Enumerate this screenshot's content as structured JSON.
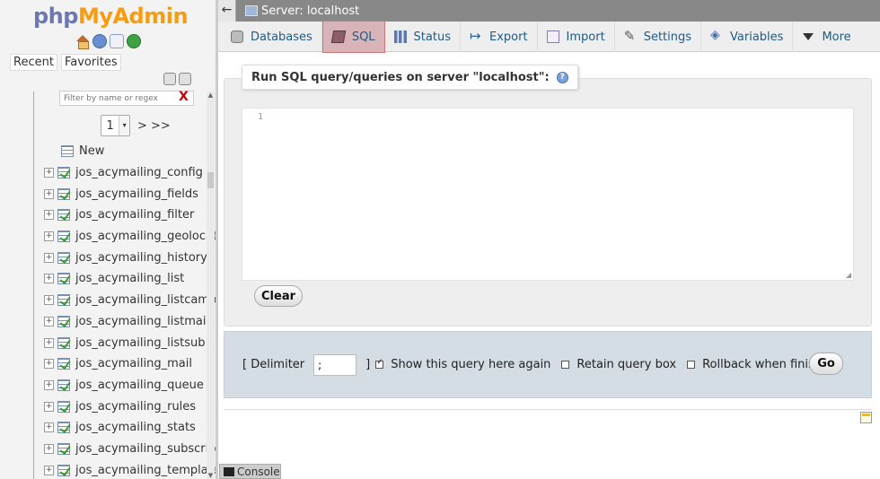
{
  "logo": {
    "php": "php",
    "myadmin": "MyAdmin"
  },
  "nav": {
    "recent_label": "Recent",
    "favorites_label": "Favorites",
    "filter_placeholder": "Filter by name or regex",
    "filter_clear": "X",
    "page_select_value": "1",
    "page_next": "> >>",
    "new_label": "New",
    "tables": [
      "jos_acymailing_config",
      "jos_acymailing_fields",
      "jos_acymailing_filter",
      "jos_acymailing_geolocati",
      "jos_acymailing_history",
      "jos_acymailing_list",
      "jos_acymailing_listcampa",
      "jos_acymailing_listmail",
      "jos_acymailing_listsub",
      "jos_acymailing_mail",
      "jos_acymailing_queue",
      "jos_acymailing_rules",
      "jos_acymailing_stats",
      "jos_acymailing_subscribe",
      "jos_acymailing_template"
    ]
  },
  "serverbar": {
    "collapse": "←",
    "label": "Server: localhost"
  },
  "tabs": [
    {
      "label": "Databases",
      "icon": "database-icon"
    },
    {
      "label": "SQL",
      "icon": "sql-icon",
      "active": true
    },
    {
      "label": "Status",
      "icon": "status-icon"
    },
    {
      "label": "Export",
      "icon": "export-icon"
    },
    {
      "label": "Import",
      "icon": "import-icon"
    },
    {
      "label": "Settings",
      "icon": "wrench-icon"
    },
    {
      "label": "Variables",
      "icon": "variables-icon"
    },
    {
      "label": "More",
      "icon": "chevron-down-icon"
    }
  ],
  "sql": {
    "legend": "Run SQL query/queries on server \"localhost\":",
    "help": "?",
    "line_number": "1",
    "clear_label": "Clear"
  },
  "options": {
    "delimiter_open": "[ Delimiter",
    "delimiter_value": ";",
    "delimiter_close": "]",
    "show_query_label": "Show this query here again",
    "show_query_checked": true,
    "retain_label": "Retain query box",
    "retain_checked": false,
    "rollback_label": "Rollback when finished",
    "rollback_checked": false,
    "go_label": "Go"
  },
  "console": {
    "label": "Console"
  }
}
